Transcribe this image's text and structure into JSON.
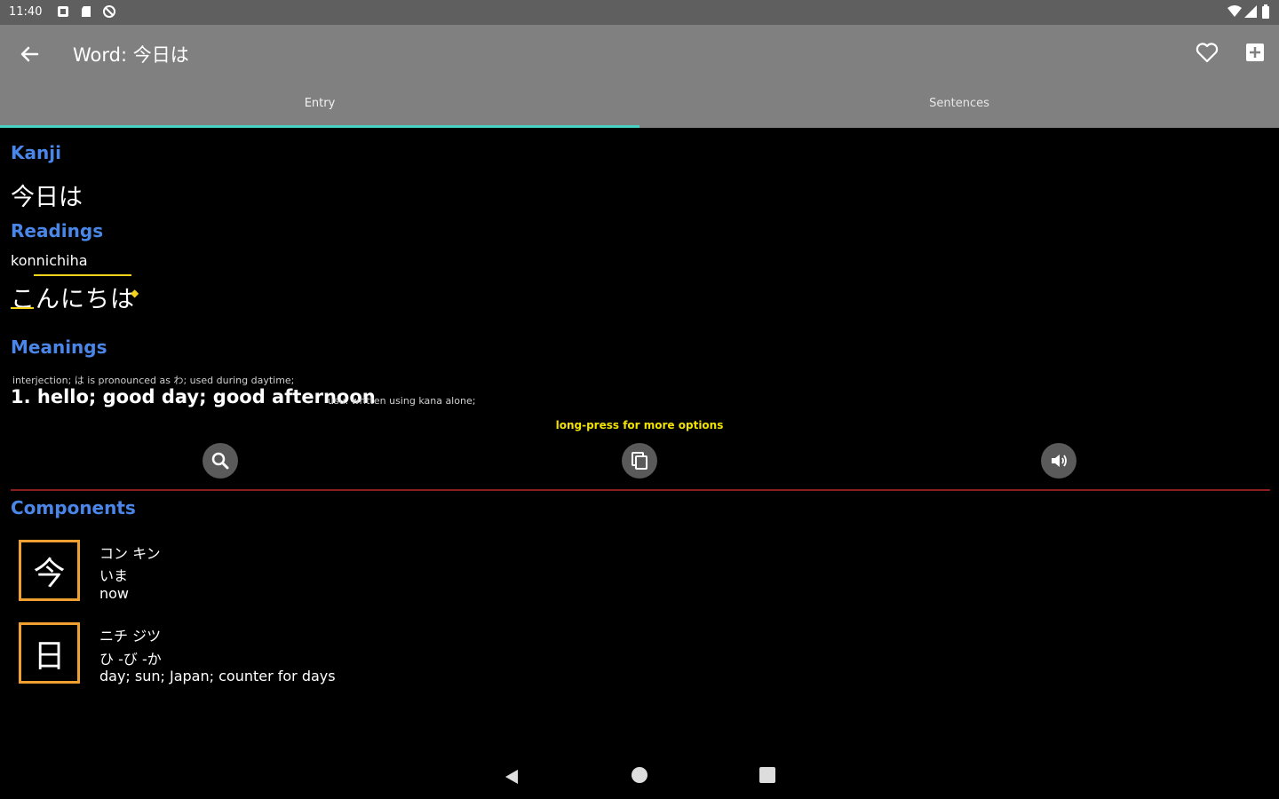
{
  "status_bar": {
    "time": "11:40"
  },
  "app_bar": {
    "title": "Word: 今日は",
    "tabs": [
      {
        "label": "Entry",
        "selected": true
      },
      {
        "label": "Sentences",
        "selected": false
      }
    ]
  },
  "kanji": {
    "heading": "Kanji",
    "value": "今日は"
  },
  "readings": {
    "heading": "Readings",
    "romaji": "konnichiha",
    "kana": "こんにちは"
  },
  "meanings": {
    "heading": "Meanings",
    "note": "interjection; は is pronounced as わ; used during daytime;",
    "items": [
      {
        "text": "1. hello; good day; good afternoon",
        "usage": "usu. written using kana alone;"
      }
    ]
  },
  "hint": "long-press for more options",
  "components": {
    "heading": "Components",
    "items": [
      {
        "kanji": "今",
        "on": "コン キン",
        "kun": "いま",
        "meaning": "now"
      },
      {
        "kanji": "日",
        "on": "ニチ ジツ",
        "kun": "ひ -び -か",
        "meaning": "day; sun; Japan; counter for days"
      }
    ]
  },
  "colors": {
    "app_bar": "#808080",
    "status_bar": "#5f5f5f",
    "tab_indicator": "#48d0c0",
    "heading_blue": "#4a86e8",
    "pitch_accent": "#f3d21c",
    "hint_yellow": "#f1e200",
    "divider": "#8a1e1e",
    "component_border": "#f0a030"
  }
}
